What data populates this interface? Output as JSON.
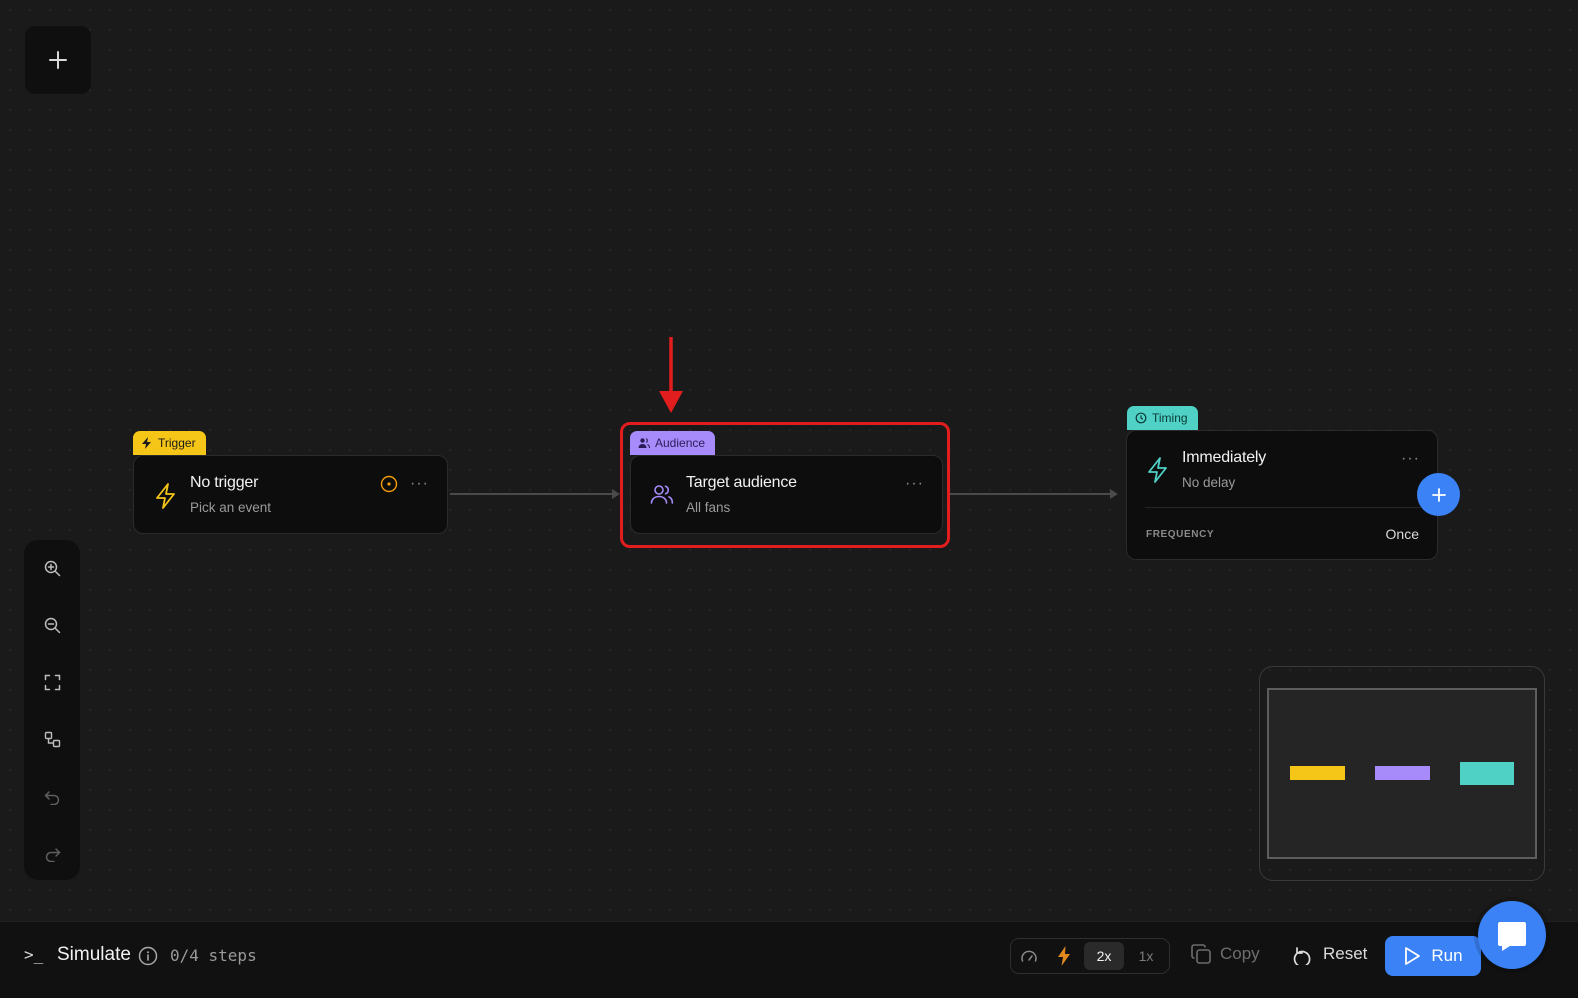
{
  "canvas": {
    "add_button": {
      "icon": "plus-icon"
    }
  },
  "nodes": {
    "trigger": {
      "chip_label": "Trigger",
      "chip_color": "#f5c518",
      "title": "No trigger",
      "subtitle": "Pick an event",
      "icon": "lightning-icon",
      "status_icon": "target-icon",
      "menu": "···"
    },
    "audience": {
      "chip_label": "Audience",
      "chip_color": "#a78bfa",
      "title": "Target audience",
      "subtitle": "All fans",
      "icon": "users-icon",
      "menu": "···",
      "highlighted": true
    },
    "timing": {
      "chip_label": "Timing",
      "chip_color": "#4fd1c5",
      "title": "Immediately",
      "subtitle": "No delay",
      "icon": "lightning-icon",
      "menu": "···",
      "frequency_label": "FREQUENCY",
      "frequency_value": "Once",
      "add_icon": "plus-icon"
    }
  },
  "annotation": {
    "highlight_color": "#e11d1d"
  },
  "toolbar": {
    "items": [
      "zoom-in-icon",
      "zoom-out-icon",
      "fit-view-icon",
      "layout-icon",
      "undo-icon",
      "redo-icon"
    ]
  },
  "minimap": {
    "node_colors": [
      "#f5c518",
      "#a78bfa",
      "#4fd1c5"
    ]
  },
  "bottom_bar": {
    "prompt_symbol": ">_",
    "simulate_label": "Simulate",
    "steps_text": "0/4 steps",
    "speeds": [
      "2x",
      "1x"
    ],
    "selected_speed": "2x",
    "copy_label": "Copy",
    "reset_label": "Reset",
    "run_label": "Run",
    "accent": "#3b82f6"
  }
}
